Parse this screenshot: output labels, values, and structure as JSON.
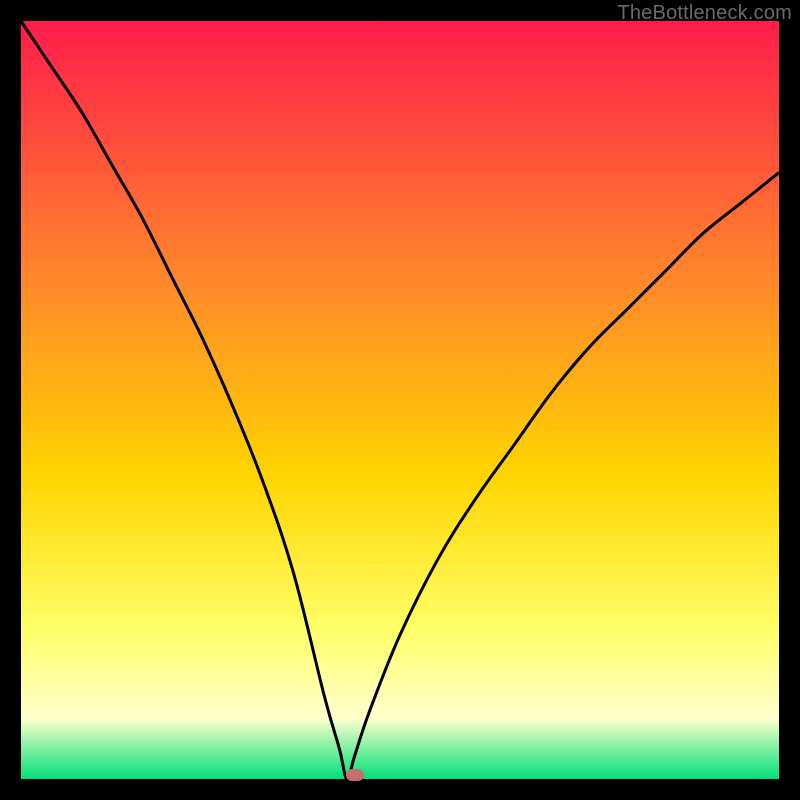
{
  "watermark": {
    "text": "TheBottleneck.com"
  },
  "colors": {
    "gradient_top": "#ff1c4b",
    "gradient_mid1": "#ff8a2a",
    "gradient_mid2": "#ffd400",
    "gradient_mid3": "#ffff66",
    "gradient_mid4": "#ffffcc",
    "gradient_bottom": "#00e07a",
    "curve": "#000000",
    "marker": "#c47070",
    "frame_bg": "#000000"
  },
  "chart_data": {
    "type": "line",
    "title": "",
    "xlabel": "",
    "ylabel": "",
    "x_range": [
      0,
      100
    ],
    "y_range": [
      0,
      100
    ],
    "optimum_x": 43,
    "marker": {
      "x": 44,
      "y": 0.5
    },
    "series": [
      {
        "name": "bottleneck-curve",
        "x": [
          0,
          4,
          8,
          12,
          16,
          20,
          24,
          28,
          32,
          36,
          40,
          42,
          43,
          44,
          46,
          50,
          55,
          60,
          65,
          70,
          75,
          80,
          85,
          90,
          95,
          100
        ],
        "y": [
          100,
          94,
          88,
          81,
          74,
          66,
          58,
          49,
          39,
          27,
          11,
          4,
          0,
          3,
          9,
          19,
          29,
          37,
          44,
          51,
          57,
          62,
          67,
          72,
          76,
          80
        ]
      }
    ],
    "background_gradient_stops": [
      {
        "pct": 0,
        "color": "#ff1c4b"
      },
      {
        "pct": 0.35,
        "color": "#ff8a2a"
      },
      {
        "pct": 0.6,
        "color": "#ffd400"
      },
      {
        "pct": 0.8,
        "color": "#ffff66"
      },
      {
        "pct": 0.92,
        "color": "#ffffcc"
      },
      {
        "pct": 1.0,
        "color": "#00e07a"
      }
    ]
  }
}
